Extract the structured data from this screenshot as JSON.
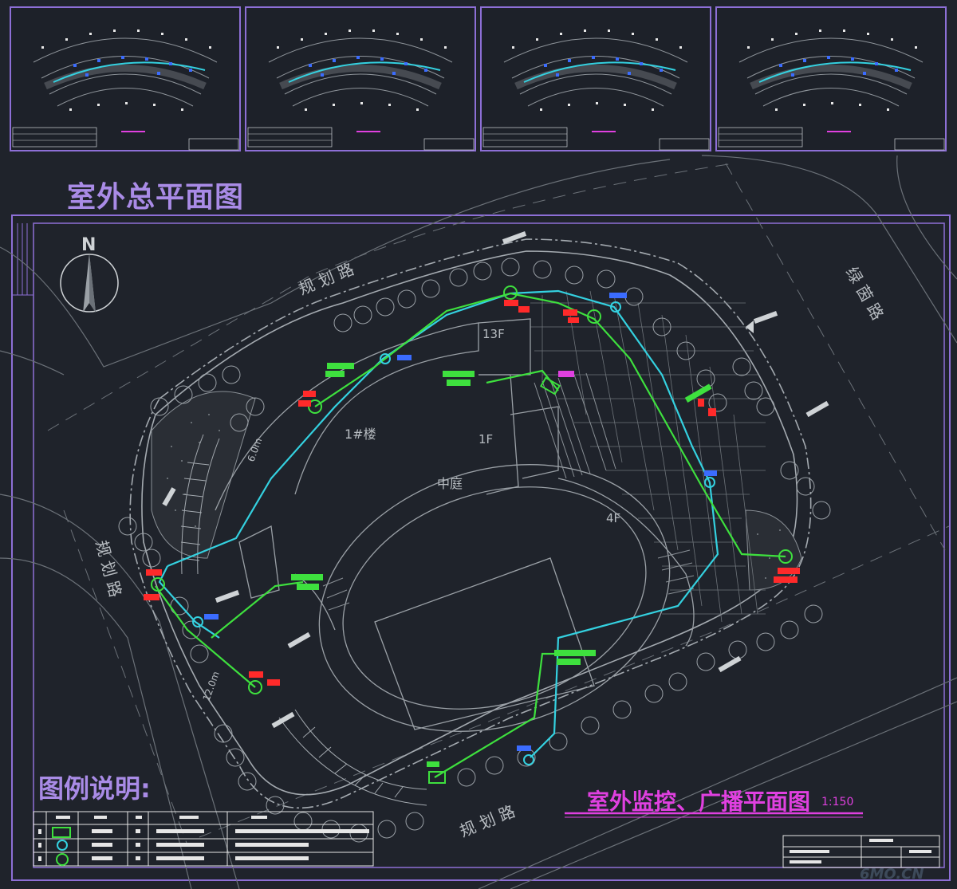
{
  "page": {
    "heading_site": "室外总平面图",
    "legend_title": "图例说明:",
    "drawing_title": "室外监控、广播平面图",
    "scale": "1:150",
    "watermark": "6MO.CN"
  },
  "plan_labels": {
    "north": "N",
    "road_top": "规 划 路",
    "road_right": "绿 茵 路",
    "road_left": "规 划 路",
    "road_bottom": "规 划 路",
    "building": "1#楼",
    "floor_13": "13F",
    "floor_1": "1F",
    "floor_4": "4F",
    "courtyard": "中庭",
    "dim_6m": "6.0m",
    "dim_12m": "12.0m"
  },
  "colors": {
    "background": "#1f232b",
    "frame": "#8d6fd6",
    "cyan_line": "#34d1e0",
    "green_line": "#3ee03e",
    "red_label": "#ff2a2a",
    "magenta": "#e040e0",
    "outline": "#9aa0a6"
  },
  "icons": [
    "north-arrow-icon",
    "camera-icon",
    "speaker-icon",
    "tree-icon"
  ]
}
